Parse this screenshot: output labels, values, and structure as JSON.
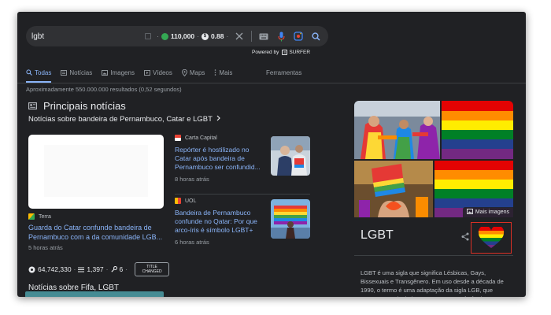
{
  "search": {
    "query": "lgbt",
    "metric1": "110,000",
    "metric2": "0.88",
    "powered_label": "Powered by",
    "powered_brand": "SURFER"
  },
  "tabs": [
    {
      "label": "Todas",
      "icon": "search-icon",
      "active": true
    },
    {
      "label": "Notícias",
      "icon": "news-icon",
      "active": false
    },
    {
      "label": "Imagens",
      "icon": "image-icon",
      "active": false
    },
    {
      "label": "Vídeos",
      "icon": "video-icon",
      "active": false
    },
    {
      "label": "Maps",
      "icon": "map-pin-icon",
      "active": false
    },
    {
      "label": "Mais",
      "icon": "more-vert-icon",
      "active": false
    }
  ],
  "tools_label": "Ferramentas",
  "result_stats": "Aproximadamente 550.000.000 resultados (0,52 segundos)",
  "top_stories": {
    "title": "Principais notícias",
    "subtitle": "Notícias sobre bandeira de Pernambuco, Catar e LGBT",
    "main_article": {
      "source": "Terra",
      "headline": "Guarda do Catar confunde bandeira de Pernambuco com a da comunidade LGB...",
      "time": "5 horas atrás"
    },
    "articles": [
      {
        "source": "Carta Capital",
        "headline": "Repórter é hostilizado no Catar após bandeira de Pernambuco ser confundid...",
        "time": "8 horas atrás"
      },
      {
        "source": "UOL",
        "headline": "Bandeira de Pernambuco confunde no Qatar: Por que arco-íris é símbolo LGBT+",
        "time": "6 horas atrás"
      }
    ],
    "stats": {
      "views": "64,742,330",
      "count": "1,397",
      "keys": "6",
      "badge_line1": "TITLE",
      "badge_line2": "CHANGED"
    },
    "more_label": "Notícias sobre Fifa, LGBT"
  },
  "knowledge_panel": {
    "title": "LGBT",
    "more_images": "Mais imagens",
    "description": "LGBT é uma sigla que significa Lésbicas, Gays, Bissexuais e Transgênero. Em uso desde a década de 1990, o termo é uma adaptação da sigla LGB, que começou a substituir o termo gay em referência ..."
  },
  "colors": {
    "background": "#202124",
    "link": "#8ab4f8",
    "text": "#bdc1c6",
    "highlight_box": "#d93025"
  }
}
